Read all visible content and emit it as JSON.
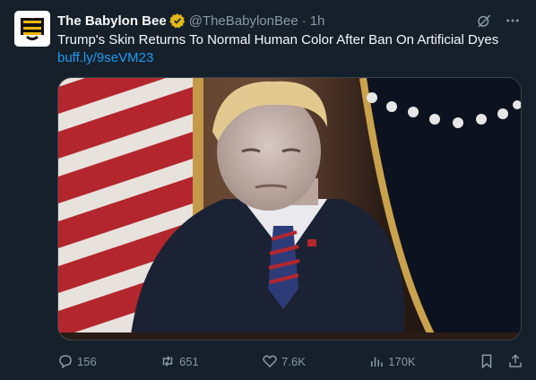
{
  "account": {
    "display_name": "The Babylon Bee",
    "handle": "@TheBabylonBee",
    "separator": "·",
    "time": "1h",
    "avatar_icon": "babylon-bee-logo-icon",
    "verified_icon": "gold-verified-badge-icon",
    "verified_color": "#e2b719"
  },
  "post": {
    "text": "Trump's Skin Returns To Normal Human Color After Ban On Artificial Dyes",
    "link": "buff.ly/9seVM23"
  },
  "actions": {
    "replies": "156",
    "reposts": "651",
    "likes": "7.6K",
    "views": "170K"
  },
  "colors": {
    "background": "#15202b",
    "text": "#f7f9f9",
    "secondary": "#8b98a5",
    "link": "#1d9bf0"
  }
}
